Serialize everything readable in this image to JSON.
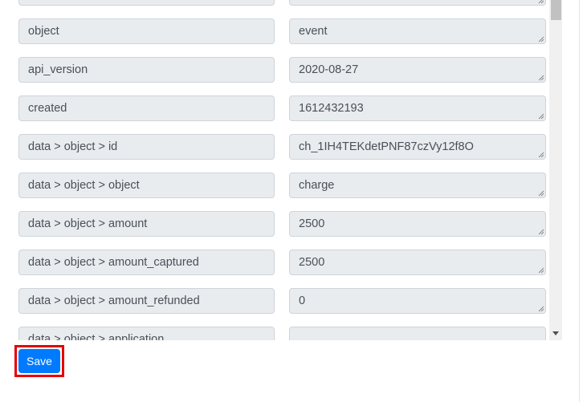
{
  "fields": [
    {
      "label": "",
      "value": ""
    },
    {
      "label": "object",
      "value": "event"
    },
    {
      "label": "api_version",
      "value": "2020-08-27"
    },
    {
      "label": "created",
      "value": "1612432193"
    },
    {
      "label": "data > object > id",
      "value": "ch_1IH4TEKdetPNF87czVy12f8O"
    },
    {
      "label": "data > object > object",
      "value": "charge"
    },
    {
      "label": "data > object > amount",
      "value": "2500"
    },
    {
      "label": "data > object > amount_captured",
      "value": "2500"
    },
    {
      "label": "data > object > amount_refunded",
      "value": "0"
    },
    {
      "label": "data > object > application",
      "value": ""
    }
  ],
  "actions": {
    "save_label": "Save"
  },
  "colors": {
    "primary": "#007bff",
    "highlight": "#e60000",
    "field_bg": "#e9ecef"
  }
}
